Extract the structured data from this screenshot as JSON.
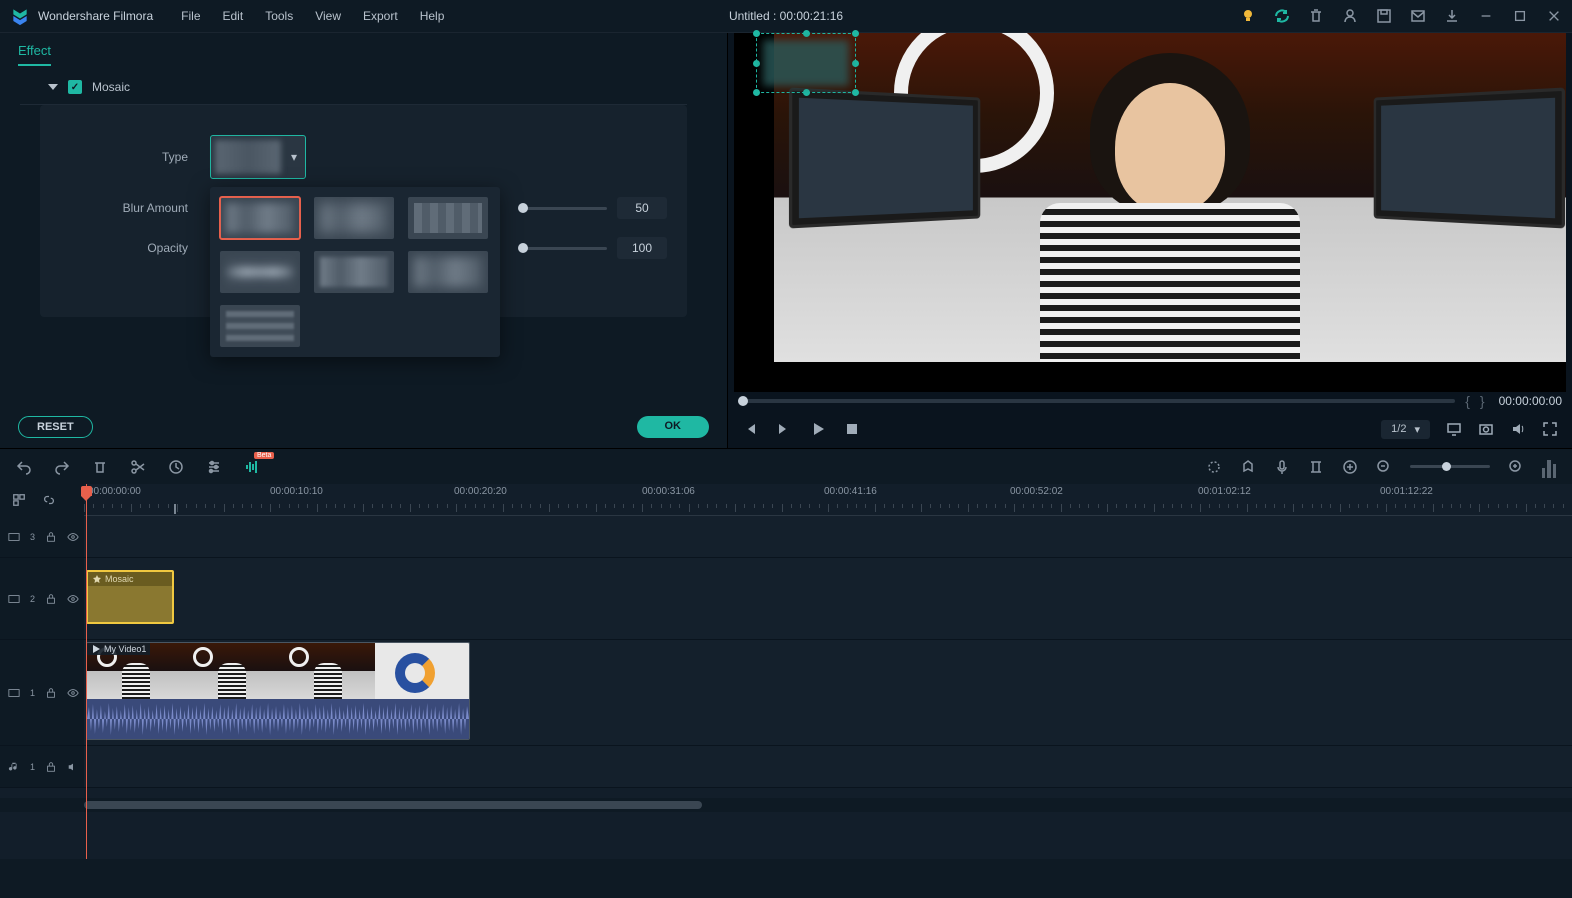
{
  "app": {
    "name": "Wondershare Filmora",
    "doc_title": "Untitled : 00:00:21:16"
  },
  "menu": [
    "File",
    "Edit",
    "Tools",
    "View",
    "Export",
    "Help"
  ],
  "effect": {
    "tab": "Effect",
    "section": "Mosaic",
    "type_label": "Type",
    "blur_label": "Blur Amount",
    "blur_value": "50",
    "opacity_label": "Opacity",
    "opacity_value": "100",
    "reset": "RESET",
    "ok": "OK"
  },
  "preview": {
    "time": "00:00:00:00",
    "zoom": "1/2"
  },
  "toolbar": {
    "badge": "Beta"
  },
  "ruler": {
    "t0": "00:00:00:00",
    "t1": "00:00:10:10",
    "t2": "00:00:20:20",
    "t3": "00:00:31:06",
    "t4": "00:00:41:16",
    "t5": "00:00:52:02",
    "t6": "00:01:02:12",
    "t7": "00:01:12:22"
  },
  "tracks": {
    "t3_icon": "3",
    "t2_icon": "2",
    "t1_icon": "1",
    "a1_icon": "1",
    "mosaic_clip": "Mosaic",
    "video_clip": "My Video1"
  }
}
